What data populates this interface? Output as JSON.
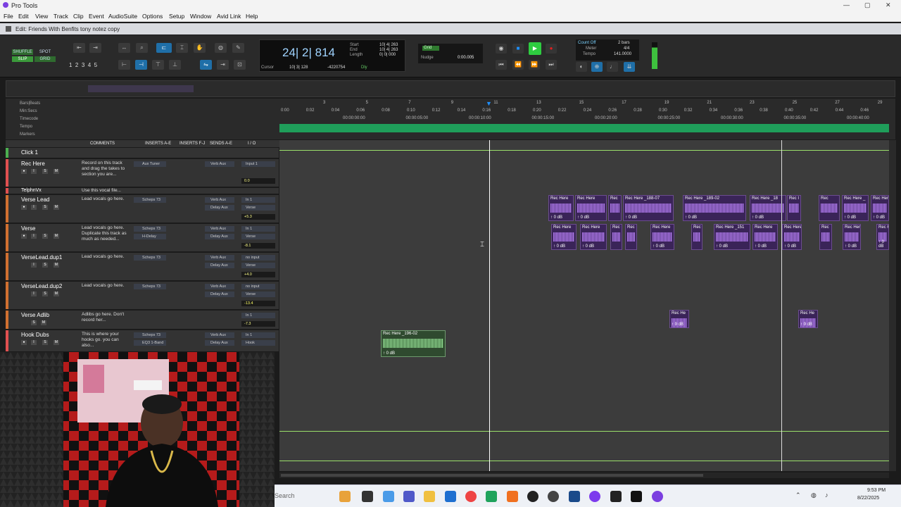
{
  "app": {
    "title": "Pro Tools",
    "edit_window_title": "Edit: Friends With Benfits tony notez copy"
  },
  "menu": [
    "File",
    "Edit",
    "View",
    "Track",
    "Clip",
    "Event",
    "AudioSuite",
    "Options",
    "Setup",
    "Window",
    "Avid Link",
    "Help"
  ],
  "edit_modes": [
    "SHUFFLE",
    "SPOT",
    "SLIP",
    "GRID"
  ],
  "zoom_presets": [
    "1",
    "2",
    "3",
    "4",
    "5"
  ],
  "counter": {
    "main": "24| 2| 814",
    "start_label": "Start",
    "end_label": "End",
    "length_label": "Length",
    "start": "10| 4| 263",
    "end": "10| 4| 263",
    "length": "0| 0| 000",
    "cursor_label": "Cursor",
    "cursor": "10| 3| 128",
    "cursor_sample": "-4220754",
    "dly": "Dly"
  },
  "grid": {
    "label": "Grid",
    "nudge_label": "Nudge",
    "nudge_value": "0:00.005"
  },
  "meter": {
    "count_off": "Count Off",
    "meter_label": "Meter",
    "meter_value": "4/4",
    "bars": "2 bars",
    "tempo_label": "Tempo",
    "tempo_value": "141.0000"
  },
  "rulers": [
    "Bars|Beats",
    "Min:Secs",
    "Timecode",
    "Tempo",
    "Markers"
  ],
  "bar_ticks": [
    "3",
    "5",
    "7",
    "9",
    "11",
    "13",
    "15",
    "17",
    "19",
    "21",
    "23",
    "25",
    "27",
    "29"
  ],
  "min_ticks": [
    "0:00",
    "0:02",
    "0:04",
    "0:06",
    "0:08",
    "0:10",
    "0:12",
    "0:14",
    "0:16",
    "0:18",
    "0:20",
    "0:22",
    "0:24",
    "0:26",
    "0:28",
    "0:30",
    "0:32",
    "0:34",
    "0:36",
    "0:38",
    "0:40",
    "0:42",
    "0:44",
    "0:46"
  ],
  "tc_ticks": [
    "00:00:00:00",
    "00:00:05:00",
    "00:00:10:00",
    "00:00:15:00",
    "00:00:20:00",
    "00:00:25:00",
    "00:00:30:00",
    "00:00:35:00",
    "00:00:40:00",
    "00:00:45:00"
  ],
  "columns": [
    "COMMENTS",
    "INSERTS A-E",
    "INSERTS F-J",
    "SENDS A-E",
    "I / O"
  ],
  "tracks": [
    {
      "name": "Click 1",
      "comment": "",
      "insert": "",
      "send": "",
      "io": "",
      "vol": ""
    },
    {
      "name": "Rec Here",
      "comment": "Record on this track and drag the takes to section you are...",
      "insert": "Aux Tuner",
      "send": "Verb Aux",
      "io": "Input 1",
      "vol": "0.0"
    },
    {
      "name": "TelphnVx",
      "comment": "Use this vocal file...",
      "insert": "",
      "send": "",
      "io": "",
      "vol": ""
    },
    {
      "name": "Verse Lead",
      "comment": "Lead vocals go here.",
      "insert": "Scheps 73",
      "send": "Verb Aux",
      "send2": "Delay Aux",
      "io": "In 1",
      "io2": "Verse",
      "vol": "+5.3"
    },
    {
      "name": "Verse",
      "comment": "Lead vocals go here. Duplicate this track as much as needed...",
      "insert": "Scheps 73",
      "insert2": "H-Delay",
      "send": "Verb Aux",
      "send2": "Delay Aux",
      "io": "In 1",
      "io2": "Verse",
      "vol": "-8.1"
    },
    {
      "name": "VerseLead.dup1",
      "comment": "Lead vocals go here.",
      "insert": "Scheps 73",
      "send": "Verb Aux",
      "send2": "Delay Aux",
      "io": "no input",
      "io2": "Verse",
      "vol": "+4.0"
    },
    {
      "name": "VerseLead.dup2",
      "comment": "Lead vocals go here.",
      "insert": "Scheps 73",
      "send": "Verb Aux",
      "send2": "Delay Aux",
      "io": "no input",
      "io2": "Verse",
      "vol": "-13.4"
    },
    {
      "name": "Verse Adlib",
      "comment": "Adlibs go here. Don't record her...",
      "insert": "",
      "send": "",
      "io": "In 1",
      "io2": "Verse",
      "vol": "-7.3"
    },
    {
      "name": "Hook Dubs",
      "comment": "This is where your hooks go. you can also...",
      "insert": "Scheps 73",
      "insert2": "EQ3 1-Band",
      "send": "Verb Aux",
      "send2": "Delay Aux",
      "io": "In 1",
      "io2": "Hook",
      "vol": ""
    }
  ],
  "clips": [
    {
      "row": "verse-lead",
      "name": "Rec Here",
      "db": "0 dB"
    },
    {
      "row": "verse-lead",
      "name": "Rec Here",
      "db": "0 dB"
    },
    {
      "row": "verse-lead",
      "name": "Rec",
      "db": ""
    },
    {
      "row": "verse-lead",
      "name": "Rec Here _188-07",
      "db": "0 dB"
    },
    {
      "row": "verse-lead",
      "name": "Rec Here _189-02",
      "db": "0 dB"
    },
    {
      "row": "verse-lead",
      "name": "Rec Here _18",
      "db": "0 dB"
    },
    {
      "row": "verse-lead",
      "name": "Rec I",
      "db": ""
    },
    {
      "row": "verse-lead",
      "name": "Rec",
      "db": ""
    },
    {
      "row": "verse-lead",
      "name": "Rec Here _",
      "db": "0 dB"
    },
    {
      "row": "verse-lead",
      "name": "Rec Here",
      "db": "0 dB"
    },
    {
      "row": "verse",
      "name": "Rec Here",
      "db": "0 dB"
    },
    {
      "row": "verse",
      "name": "Rec Here",
      "db": "0 dB"
    },
    {
      "row": "verse",
      "name": "Rec",
      "db": ""
    },
    {
      "row": "verse",
      "name": "Rec",
      "db": ""
    },
    {
      "row": "verse",
      "name": "Rec Here",
      "db": "0 dB"
    },
    {
      "row": "verse",
      "name": "Rec",
      "db": ""
    },
    {
      "row": "verse",
      "name": "Rec Here _151",
      "db": "0 dB"
    },
    {
      "row": "verse",
      "name": "Rec Here",
      "db": "0 dB"
    },
    {
      "row": "verse",
      "name": "Rec Here",
      "db": "0 dB"
    },
    {
      "row": "verse",
      "name": "Rec",
      "db": ""
    },
    {
      "row": "verse",
      "name": "Rec Here",
      "db": "0 dB"
    },
    {
      "row": "verse",
      "name": "Rec Her",
      "db": "0 dB"
    },
    {
      "row": "adlib",
      "name": "Rec He",
      "db": "0 dB"
    },
    {
      "row": "adlib",
      "name": "Rec He",
      "db": "0 dB"
    },
    {
      "row": "hook",
      "name": "Rec Here _196-02",
      "db": "0 dB"
    }
  ],
  "taskbar": {
    "search": "Search",
    "time": "9:53 PM",
    "date": "8/22/2025"
  },
  "colors": {
    "accent": "#1f6fa8",
    "play": "#2ecc40",
    "record": "#e02020",
    "clip": "#3a2458",
    "timeline_line": "#9be06b",
    "cursor": "#ffffff"
  }
}
